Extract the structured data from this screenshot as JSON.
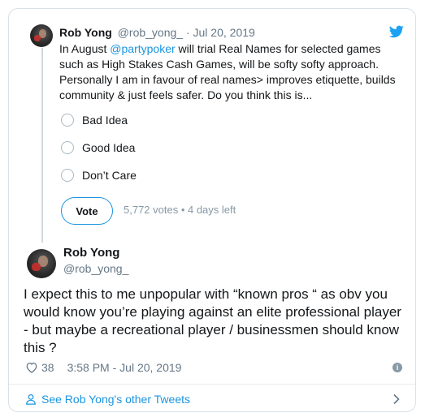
{
  "quoted_tweet": {
    "author_name": "Rob Yong",
    "meta": "@rob_yong_ · Jul 20, 2019",
    "text_before_mention": "In August ",
    "mention": "@partypoker",
    "text_after_mention": " will trial Real Names for selected games such as High Stakes Cash Games, will be softy softy approach. Personally I am in favour of real names> improves etiquette, builds community & just feels safer. Do you think this is...",
    "poll": {
      "options": [
        "Bad Idea",
        "Good Idea",
        "Don’t Care"
      ],
      "vote_label": "Vote",
      "summary": "5,772 votes • 4 days left"
    }
  },
  "tweet": {
    "author_name": "Rob Yong",
    "handle": "@rob_yong_",
    "text": "I expect this to me unpopular with “known pros “ as obv you would know you’re playing against an elite professional player - but maybe a recreational player / businessmen should know this ?",
    "likes": "38",
    "timestamp": "3:58 PM - Jul 20, 2019"
  },
  "footer": {
    "link": "See Rob Yong's other Tweets"
  },
  "colors": {
    "accent": "#1b95e0",
    "muted": "#657786",
    "text": "#14171a"
  },
  "icons": [
    "twitter-bird-icon",
    "heart-icon",
    "info-icon",
    "person-icon",
    "chevron-right-icon"
  ]
}
